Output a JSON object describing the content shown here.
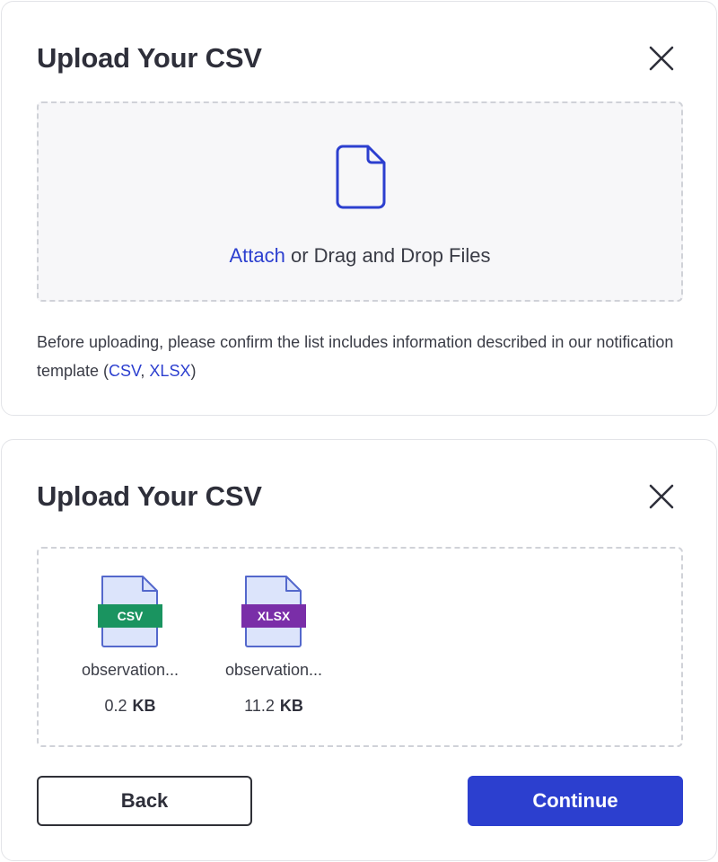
{
  "upload_empty": {
    "title": "Upload Your CSV",
    "close_icon": "close-icon",
    "dropzone": {
      "icon": "document-icon",
      "attach_link": "Attach",
      "instruction": " or Drag and Drop Files"
    },
    "note": {
      "text_before": "Before uploading, please confirm the list includes information described in our notification template (",
      "csv_link": "CSV",
      "separator": ", ",
      "xlsx_link": "XLSX",
      "text_after": ")"
    }
  },
  "upload_files": {
    "title": "Upload Your CSV",
    "close_icon": "close-icon",
    "files": [
      {
        "icon": "csv-file-icon",
        "type_label": "CSV",
        "badge_color": "#1a9460",
        "name": "observation...",
        "size_value": "0.2",
        "size_unit": "KB"
      },
      {
        "icon": "xlsx-file-icon",
        "type_label": "XLSX",
        "badge_color": "#7a2ea8",
        "name": "observation...",
        "size_value": "11.2",
        "size_unit": "KB"
      }
    ],
    "back_label": "Back",
    "continue_label": "Continue"
  },
  "colors": {
    "accent": "#2c3fcf",
    "file_icon_fill": "#dce4fb",
    "file_icon_stroke": "#5468cc"
  }
}
